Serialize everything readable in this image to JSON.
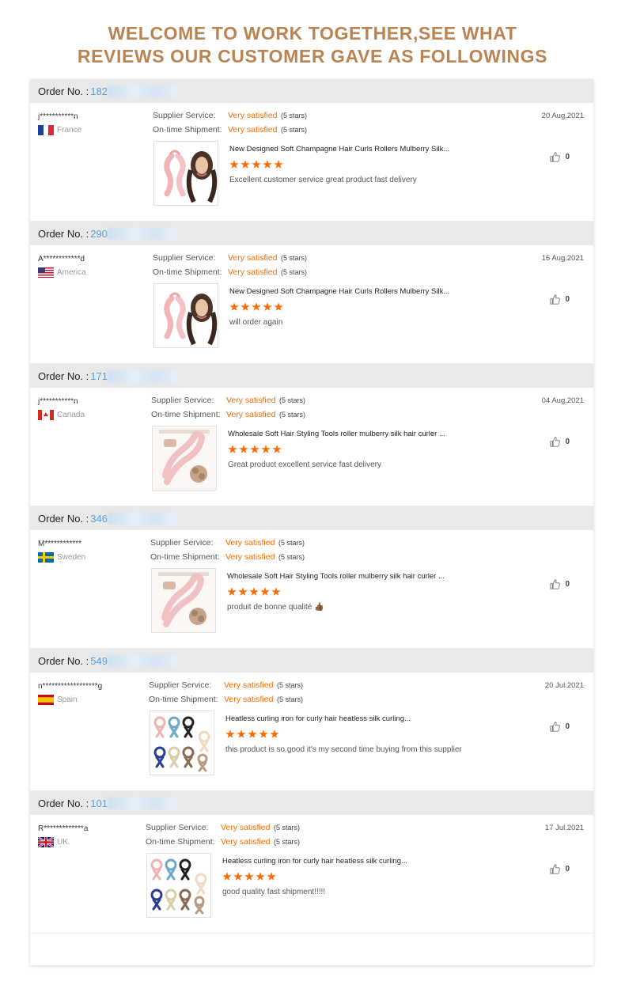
{
  "headline": {
    "line1": "WELCOME TO WORK TOGETHER,SEE WHAT",
    "line2": "REVIEWS OUR CUSTOMER GAVE AS FOLLOWINGS"
  },
  "labels": {
    "order_no": "Order No. :",
    "supplier_service": "Supplier Service:",
    "ontime_shipment": "On-time Shipment:"
  },
  "colors": {
    "accent": "#ff6a00",
    "headline": "#b98452",
    "order_link": "#5a9bd6"
  },
  "reviews": [
    {
      "order_prefix": "182",
      "buyer": "j***********n",
      "country": "France",
      "flag": "flag-france-icon",
      "supplier_rating": "Very satisfied",
      "supplier_stars": "(5 stars)",
      "shipment_rating": "Very satisfied",
      "shipment_stars": "(5 stars)",
      "date": "20 Aug.2021",
      "product": "New Designed Soft Champagne Hair Curls Rollers Mulberry Silk...",
      "comment": "Excellent customer service great product fast delivery",
      "likes": "0",
      "thumb": "pink-curler-with-model"
    },
    {
      "order_prefix": "290",
      "buyer": "A************d",
      "country": "America",
      "flag": "flag-usa-icon",
      "supplier_rating": "Very satisfied",
      "supplier_stars": "(5 stars)",
      "shipment_rating": "Very satisfied",
      "shipment_stars": "(5 stars)",
      "date": "16 Aug.2021",
      "product": "New Designed Soft Champagne Hair Curls Rollers Mulberry Silk...",
      "comment": "will order again",
      "likes": "0",
      "thumb": "pink-curler-with-model"
    },
    {
      "order_prefix": "171",
      "buyer": "j***********n",
      "country": "Canada",
      "flag": "flag-canada-icon",
      "supplier_rating": "Very satisfied",
      "supplier_stars": "(5 stars)",
      "shipment_rating": "Very satisfied",
      "shipment_stars": "(5 stars)",
      "date": "04 Aug.2021",
      "product": "Wholesale Soft Hair Styling Tools roller mulberry silk hair curler ...",
      "comment": "Great product excellent service fast delivery",
      "likes": "0",
      "thumb": "pink-curler-with-scrunchie"
    },
    {
      "order_prefix": "346",
      "buyer": "M************",
      "country": "Sweden",
      "flag": "flag-sweden-icon",
      "supplier_rating": "Very satisfied",
      "supplier_stars": "(5 stars)",
      "shipment_rating": "Very satisfied",
      "shipment_stars": "(5 stars)",
      "date": "",
      "product": "Wholesale Soft Hair Styling Tools roller mulberry silk hair curler ...",
      "comment": "produit de bonne qualité 👍🏾",
      "likes": "0",
      "thumb": "pink-curler-with-scrunchie"
    },
    {
      "order_prefix": "549",
      "buyer": "n******************g",
      "country": "Spain",
      "flag": "flag-spain-icon",
      "supplier_rating": "Very satisfied",
      "supplier_stars": "(5 stars)",
      "shipment_rating": "Very satisfied",
      "shipment_stars": "(5 stars)",
      "date": "20 Jul.2021",
      "product": "Heatless curling iron for curly hair heatless silk curling...",
      "comment": "this product is so good it's my second time buying from this supplier",
      "likes": "0",
      "thumb": "multicolor-curlers"
    },
    {
      "order_prefix": "101",
      "buyer": "R*************a",
      "country": "UK.",
      "flag": "flag-uk-icon",
      "supplier_rating": "Very satisfied",
      "supplier_stars": "(5 stars)",
      "shipment_rating": "Very satisfied",
      "shipment_stars": "(5 stars)",
      "date": "17 Jul.2021",
      "product": "Heatless curling iron for curly hair heatless silk curling...",
      "comment": "good quality fast shipment!!!!!",
      "likes": "0",
      "thumb": "multicolor-curlers"
    }
  ]
}
